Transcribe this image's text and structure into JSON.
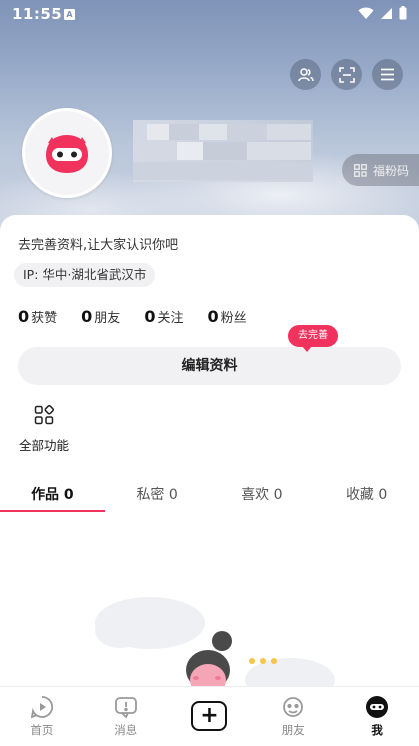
{
  "status_bar": {
    "time": "11:55",
    "app_badge": "A"
  },
  "header": {
    "qr_chip_label": "福粉码"
  },
  "profile": {
    "bio": "去完善资料,让大家认识你吧",
    "ip_location": "IP: 华中·湖北省武汉市",
    "stats": [
      {
        "num": "0",
        "label": "获赞"
      },
      {
        "num": "0",
        "label": "朋友"
      },
      {
        "num": "0",
        "label": "关注"
      },
      {
        "num": "0",
        "label": "粉丝"
      }
    ],
    "edit_button": "编辑资料",
    "edit_bubble": "去完善",
    "all_functions": "全部功能"
  },
  "tabs": [
    {
      "label": "作品 0",
      "active": true
    },
    {
      "label": "私密 0",
      "active": false
    },
    {
      "label": "喜欢 0",
      "active": false
    },
    {
      "label": "收藏 0",
      "active": false
    }
  ],
  "bottom_nav": [
    {
      "label": "首页",
      "icon": "home-play-icon"
    },
    {
      "label": "消息",
      "icon": "message-icon"
    },
    {
      "label": "",
      "icon": "plus-icon"
    },
    {
      "label": "朋友",
      "icon": "friends-icon"
    },
    {
      "label": "我",
      "icon": "me-icon",
      "active": true
    }
  ],
  "colors": {
    "accent": "#f0325d",
    "chip_bg": "#f1f1f4"
  }
}
